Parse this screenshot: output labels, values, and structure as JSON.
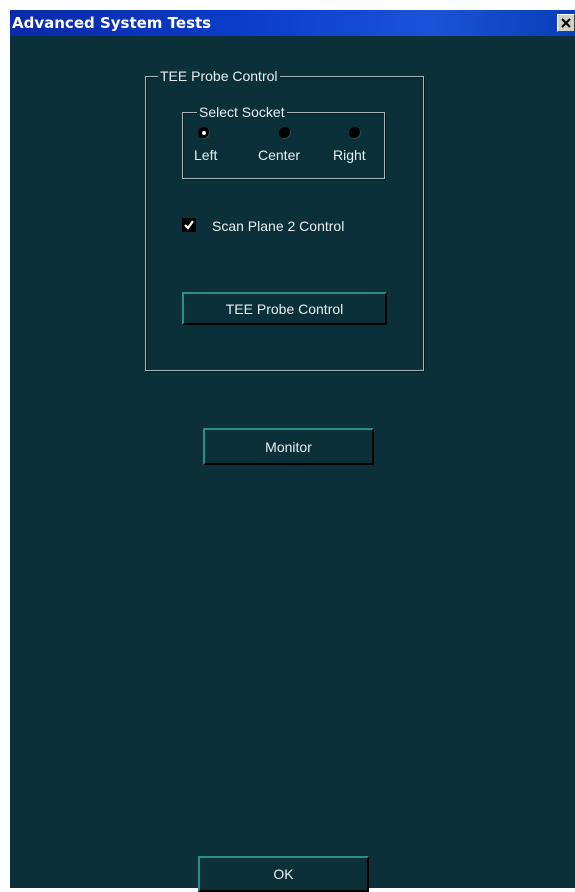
{
  "window": {
    "title": "Advanced System Tests"
  },
  "tee_probe_group": {
    "label": "TEE Probe Control",
    "select_socket": {
      "label": "Select Socket",
      "options": [
        "Left",
        "Center",
        "Right"
      ],
      "selected": "Left"
    },
    "scan_plane_checkbox": {
      "label": "Scan Plane 2 Control",
      "checked": true
    },
    "tee_probe_button": "TEE Probe Control"
  },
  "monitor_button": "Monitor",
  "ok_button": "OK",
  "colors": {
    "background": "#0b3039",
    "titlebar": "#0b3cc8",
    "text": "#e8eef0"
  },
  "icons": {
    "close": "close-icon",
    "check": "check-icon"
  }
}
